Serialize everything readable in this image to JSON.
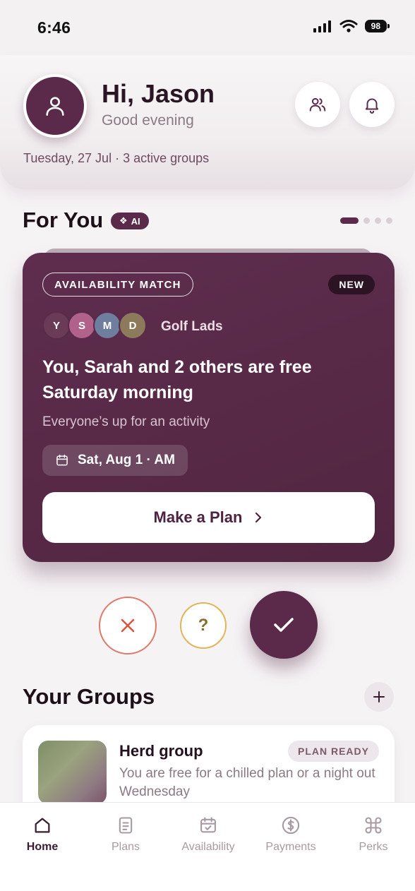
{
  "status_bar": {
    "time": "6:46",
    "battery": "98"
  },
  "header": {
    "greeting": "Hi, Jason",
    "subgreeting": "Good evening",
    "date_line": "Tuesday, 27 Jul · 3 active groups",
    "icons": {
      "avatar": "user-icon",
      "friends": "users-icon",
      "notifications": "bell-icon"
    }
  },
  "for_you": {
    "title": "For You",
    "ai_badge": "AI",
    "pager": {
      "count": 4,
      "active": 1
    }
  },
  "card": {
    "tag": "AVAILABILITY MATCH",
    "new_badge": "NEW",
    "members": [
      {
        "initial": "Y",
        "color": "#6b3a57"
      },
      {
        "initial": "S",
        "color": "#b0628a"
      },
      {
        "initial": "M",
        "color": "#6e7e9e"
      },
      {
        "initial": "D",
        "color": "#8c7a5a"
      }
    ],
    "group_name": "Golf Lads",
    "headline": "You, Sarah and 2 others are free Saturday morning",
    "subtext": "Everyone’s up for an activity",
    "date_chip": "Sat, Aug 1 · AM",
    "cta": "Make a Plan"
  },
  "actions": {
    "maybe_label": "?"
  },
  "groups": {
    "title": "Your Groups",
    "items": [
      {
        "name": "Herd group",
        "badge": "PLAN READY",
        "description": "You are free for a chilled plan or a night out Wednesday"
      }
    ]
  },
  "nav": {
    "items": [
      {
        "label": "Home",
        "icon": "home-icon",
        "active": true
      },
      {
        "label": "Plans",
        "icon": "document-icon",
        "active": false
      },
      {
        "label": "Availability",
        "icon": "calendar-check-icon",
        "active": false
      },
      {
        "label": "Payments",
        "icon": "dollar-icon",
        "active": false
      },
      {
        "label": "Perks",
        "icon": "command-icon",
        "active": false
      }
    ]
  },
  "colors": {
    "brand": "#5b2a4a",
    "decline": "#e07a6a",
    "maybe": "#e3b45a"
  }
}
